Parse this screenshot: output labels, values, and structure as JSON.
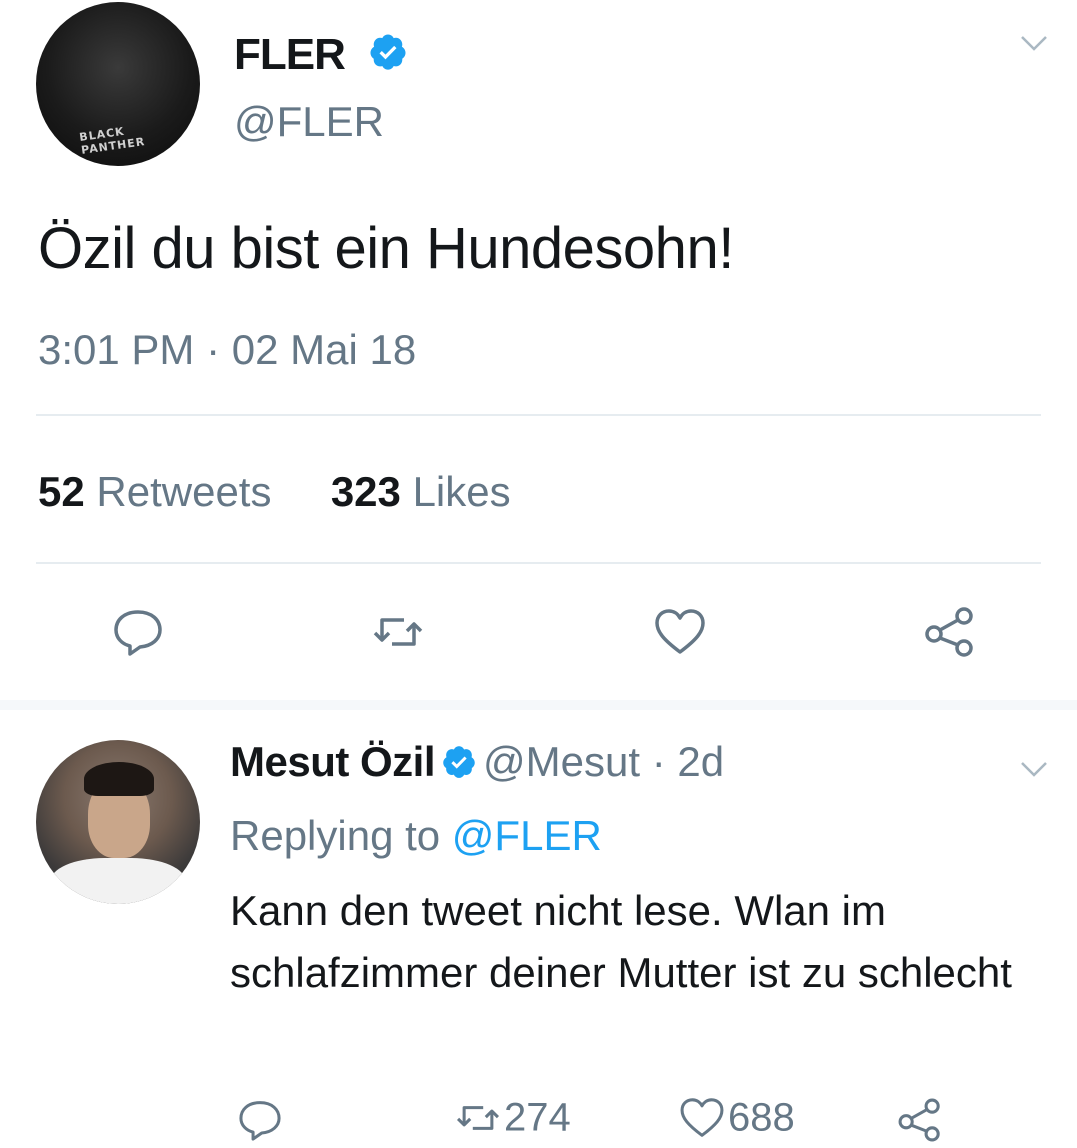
{
  "main_tweet": {
    "name": "FLER",
    "handle": "@FLER",
    "avatar_badge": "BLACK PANTHER",
    "text": "Özil du bist ein Hundesohn!",
    "timestamp": "3:01 PM · 02 Mai 18",
    "retweets_count": "52",
    "retweets_label": "Retweets",
    "likes_count": "323",
    "likes_label": "Likes",
    "actions": [
      "reply-icon",
      "retweet-icon",
      "like-icon",
      "share-icon"
    ]
  },
  "reply_tweet": {
    "name": "Mesut Özil",
    "handle": "@Mesut",
    "time_ago": "· 2d",
    "replying_prefix": "Replying to",
    "replying_mention": "@FLER",
    "text": "Kann den tweet nicht lese. Wlan im schlafzimmer deiner Mutter ist zu schlecht",
    "retweets_count": "274",
    "likes_count": "688"
  },
  "colors": {
    "verified": "#1da1f2",
    "secondary_text": "#657786",
    "primary_text": "#14171a",
    "mention": "#1da1f2",
    "divider": "#e6ecf0"
  }
}
